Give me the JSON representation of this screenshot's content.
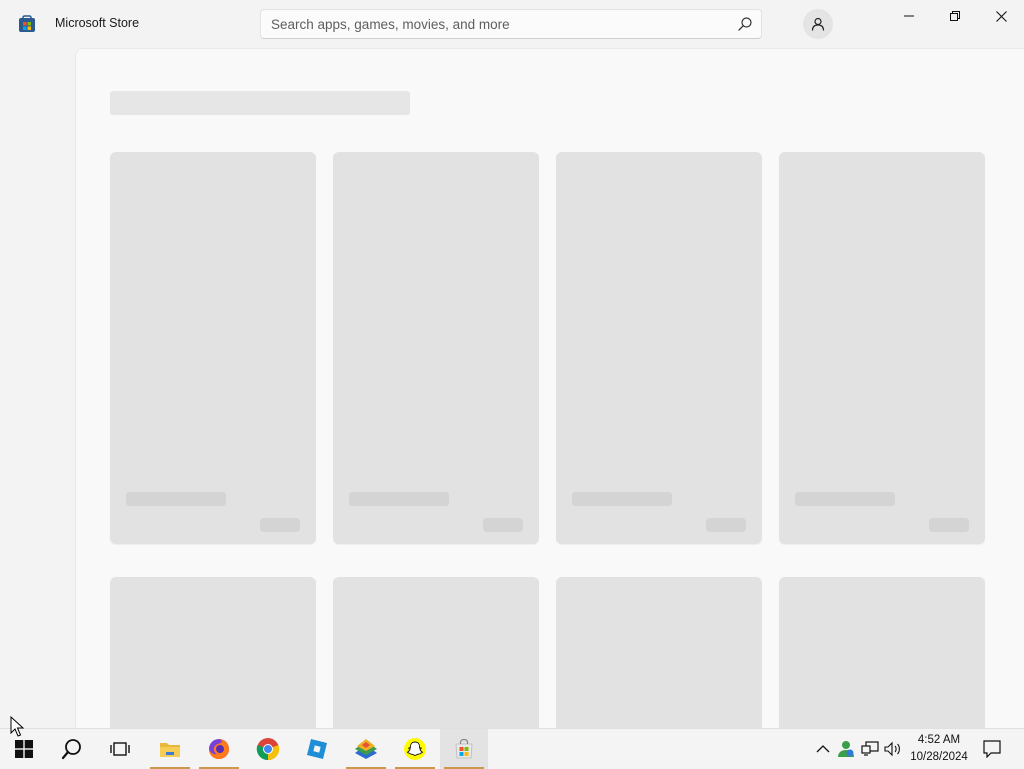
{
  "window": {
    "title": "Microsoft Store",
    "search_placeholder": "Search apps, games, movies, and more"
  },
  "icons": {
    "app_logo": "microsoft-store-icon",
    "search": "search-icon",
    "account": "person-icon",
    "minimize": "minimize-icon",
    "maximize": "restore-icon",
    "close": "close-icon"
  },
  "content": {
    "state": "loading",
    "card_rows": 2,
    "cards_per_row": 4
  },
  "taskbar": {
    "apps": [
      {
        "name": "start-button",
        "icon": "windows-logo"
      },
      {
        "name": "search-button",
        "icon": "search-circle"
      },
      {
        "name": "task-view-button",
        "icon": "task-view"
      },
      {
        "name": "file-explorer",
        "icon": "folder"
      },
      {
        "name": "firefox",
        "icon": "firefox"
      },
      {
        "name": "chrome",
        "icon": "chrome"
      },
      {
        "name": "roblox-studio",
        "icon": "roblox-studio"
      },
      {
        "name": "app-stacked",
        "icon": "stacked-app"
      },
      {
        "name": "snapchat",
        "icon": "snapchat"
      },
      {
        "name": "microsoft-store",
        "icon": "store-bag",
        "active": true
      }
    ],
    "tray": {
      "time": "4:52 AM",
      "date": "10/28/2024"
    }
  },
  "colors": {
    "background": "#f3f3f3",
    "content": "#f9f9f9",
    "skeleton": "#e2e2e2",
    "accent_underline": "#c99a4b"
  }
}
